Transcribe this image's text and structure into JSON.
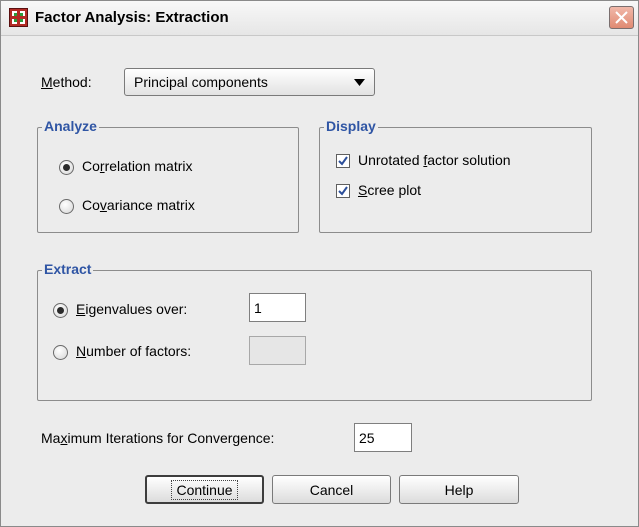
{
  "window": {
    "title": "Factor Analysis: Extraction"
  },
  "method": {
    "label_pre": "",
    "label_key": "M",
    "label_post": "ethod:",
    "value": "Principal components"
  },
  "analyze": {
    "title": "Analyze",
    "correlation": {
      "pre": "Co",
      "key": "r",
      "post": "relation matrix",
      "checked": true
    },
    "covariance": {
      "pre": "Co",
      "key": "v",
      "post": "ariance matrix",
      "checked": false
    }
  },
  "display": {
    "title": "Display",
    "unrotated": {
      "pre": "Unrotated ",
      "key": "f",
      "post": "actor solution",
      "checked": true
    },
    "scree": {
      "pre": "",
      "key": "S",
      "post": "cree plot",
      "checked": true
    }
  },
  "extract": {
    "title": "Extract",
    "eigen": {
      "pre": "",
      "key": "E",
      "post": "igenvalues over:",
      "value": "1",
      "checked": true
    },
    "nfactors": {
      "pre": "",
      "key": "N",
      "post": "umber of factors:",
      "value": "",
      "checked": false
    }
  },
  "iterations": {
    "pre": "Ma",
    "key": "x",
    "post": "imum Iterations for Convergence:",
    "value": "25"
  },
  "buttons": {
    "continue": "Continue",
    "cancel": "Cancel",
    "help": "Help"
  },
  "colors": {
    "group_title": "#2f55a4",
    "dialog_bg": "#ececec",
    "close_button": "#e08a72"
  },
  "icons": {
    "app": "spss-dialog-icon",
    "close": "close-icon",
    "dropdown": "triangle-down-icon",
    "checkmark": "checkmark-icon"
  }
}
